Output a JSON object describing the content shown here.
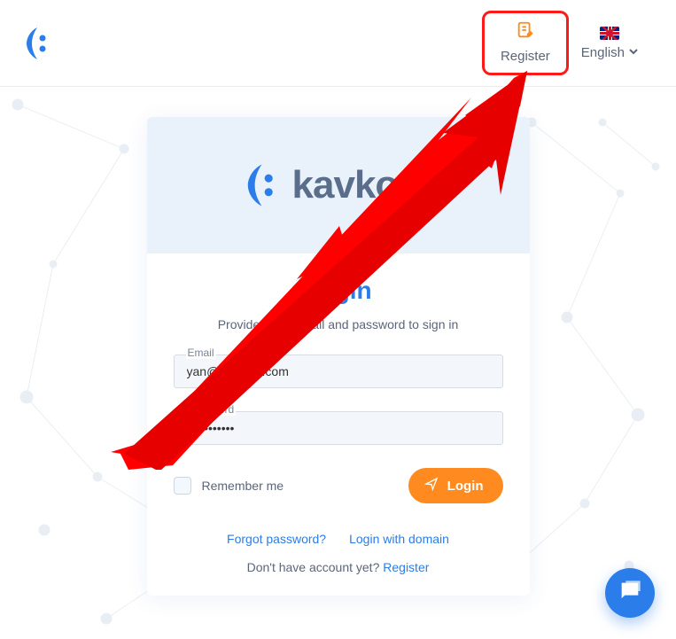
{
  "header": {
    "register_label": "Register",
    "language_label": "English"
  },
  "brand": {
    "name": "kavkom"
  },
  "login": {
    "title": "Login",
    "subtitle": "Provide your e-mail and password to sign in",
    "email_label": "Email",
    "email_value": "yan@kavkom.com",
    "password_label": "Password",
    "password_value": "•••••••••••",
    "remember_label": "Remember me",
    "button_label": "Login",
    "forgot_label": "Forgot password?",
    "domain_label": "Login with domain",
    "signup_prompt": "Don't have account yet? ",
    "signup_link": "Register"
  }
}
